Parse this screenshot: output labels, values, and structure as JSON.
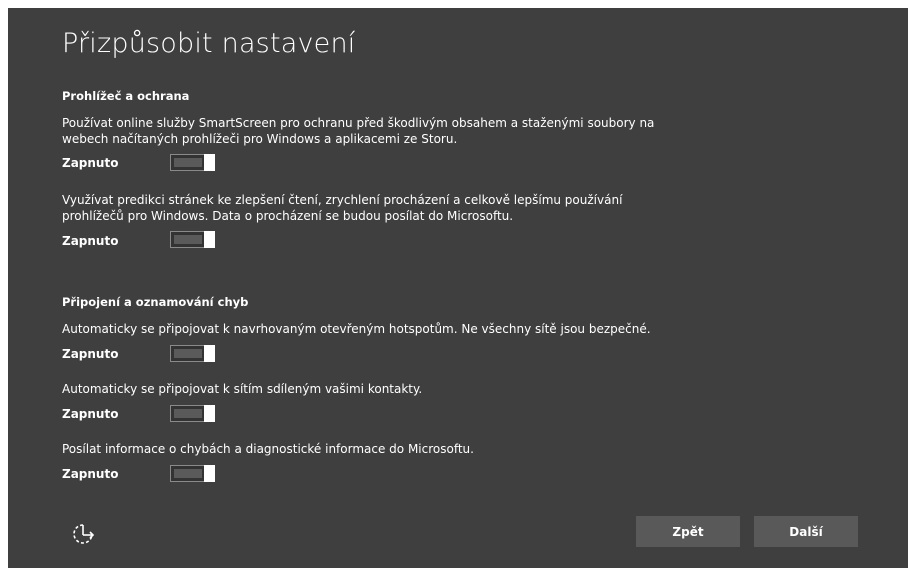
{
  "page": {
    "title": "Přizpůsobit nastavení"
  },
  "sections": [
    {
      "heading": "Prohlížeč a ochrana",
      "settings": [
        {
          "text": "Používat online služby SmartScreen pro ochranu před škodlivým obsahem a staženými soubory na webech načítaných prohlížeči pro Windows a aplikacemi ze Storu.",
          "state_label": "Zapnuto",
          "on": true
        },
        {
          "text": "Využívat predikci stránek ke zlepšení čtení, zrychlení procházení a celkově lepšímu používání prohlížečů pro Windows. Data o procházení se budou posílat do Microsoftu.",
          "state_label": "Zapnuto",
          "on": true
        }
      ]
    },
    {
      "heading": "Připojení a oznamování chyb",
      "settings": [
        {
          "text": "Automaticky se připojovat k navrhovaným otevřeným hotspotům. Ne všechny sítě jsou bezpečné.",
          "state_label": "Zapnuto",
          "on": true
        },
        {
          "text": "Automaticky se připojovat k sítím sdíleným vašimi kontakty.",
          "state_label": "Zapnuto",
          "on": true
        },
        {
          "text": "Posílat informace o chybách a diagnostické informace do Microsoftu.",
          "state_label": "Zapnuto",
          "on": true
        }
      ]
    }
  ],
  "footer": {
    "back_label": "Zpět",
    "next_label": "Další",
    "accessibility_icon": "ease-of-access-icon"
  },
  "colors": {
    "background": "#3f3f3f",
    "button": "#595959",
    "text": "#ffffff"
  }
}
